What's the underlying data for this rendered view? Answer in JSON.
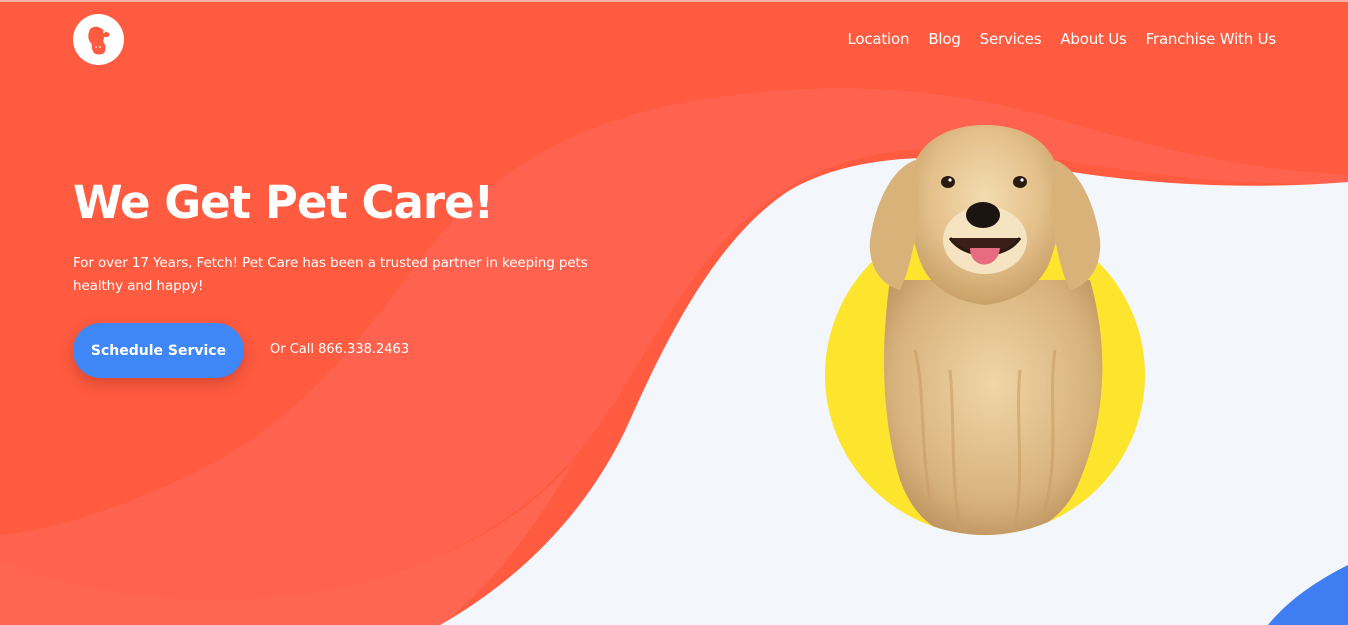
{
  "logo": {
    "icon": "dog-cat-logo-icon"
  },
  "nav": {
    "items": [
      {
        "label": "Location"
      },
      {
        "label": "Blog"
      },
      {
        "label": "Services"
      },
      {
        "label": "About Us"
      },
      {
        "label": "Franchise With Us"
      }
    ]
  },
  "hero": {
    "title": "We Get Pet Care!",
    "subtitle": "For over 17 Years, Fetch! Pet Care has been a trusted partner in keeping pets healthy and happy!",
    "cta_label": "Schedule Service",
    "call_text": "Or Call 866.338.2463",
    "image": "golden-retriever-photo"
  },
  "colors": {
    "primary_red": "#fe5b40",
    "wave_red": "#ff6350",
    "background_light": "#f3f6fa",
    "button_blue": "#3f86f7",
    "circle_yellow": "#fde52d",
    "text_white": "#ffffff"
  }
}
